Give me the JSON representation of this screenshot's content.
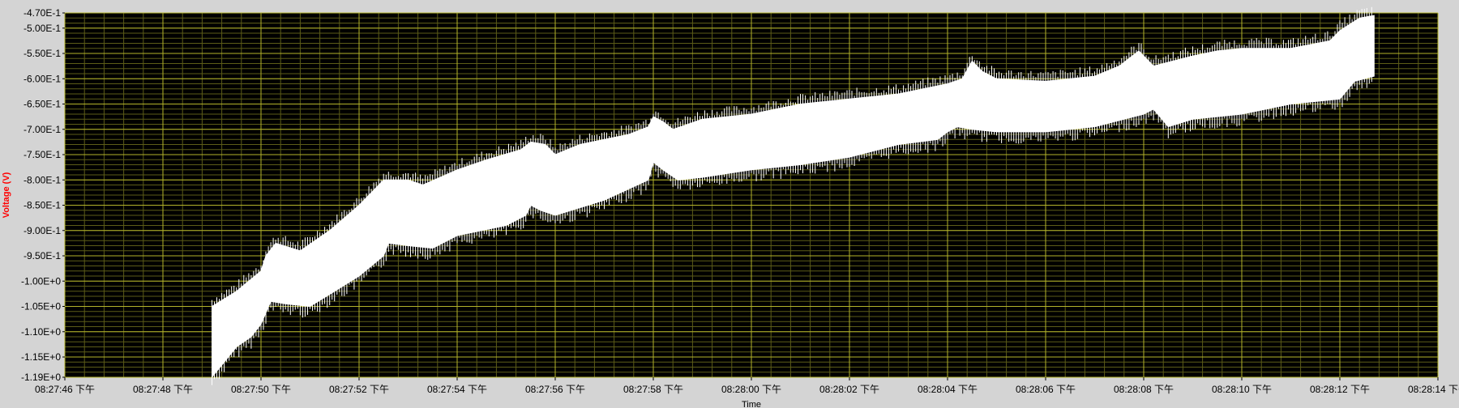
{
  "chart_data": {
    "type": "area",
    "xlabel": "Time",
    "ylabel": "Voltage (V)",
    "xlim": [
      0,
      28
    ],
    "ylim": [
      -1.19,
      -0.47
    ],
    "x_ticks": [
      0,
      2,
      4,
      6,
      8,
      10,
      12,
      14,
      16,
      18,
      20,
      22,
      24,
      26,
      28
    ],
    "x_tick_labels": [
      "08:27:46 下午",
      "08:27:48 下午",
      "08:27:50 下午",
      "08:27:52 下午",
      "08:27:54 下午",
      "08:27:56 下午",
      "08:27:58 下午",
      "08:28:00 下午",
      "08:28:02 下午",
      "08:28:04 下午",
      "08:28:06 下午",
      "08:28:08 下午",
      "08:28:10 下午",
      "08:28:12 下午",
      "08:28:14 下午"
    ],
    "y_ticks": [
      -0.47,
      -0.5,
      -0.55,
      -0.6,
      -0.65,
      -0.7,
      -0.75,
      -0.8,
      -0.85,
      -0.9,
      -0.95,
      -1.0,
      -1.05,
      -1.1,
      -1.15,
      -1.19
    ],
    "y_tick_labels": [
      "-4.70E-1",
      "-5.00E-1",
      "-5.50E-1",
      "-6.00E-1",
      "-6.50E-1",
      "-7.00E-1",
      "-7.50E-1",
      "-8.00E-1",
      "-8.50E-1",
      "-9.00E-1",
      "-9.50E-1",
      "-1.00E+0",
      "-1.05E+0",
      "-1.10E+0",
      "-1.15E+0",
      "-1.19E+0"
    ],
    "grid": true,
    "colors": {
      "plot_background": "#000000",
      "signal": "#ffffff",
      "major_grid": "#b3b32a",
      "minor_grid": "#5c5c18",
      "ylabel": "#ff0000",
      "frame": "#d4d4d4"
    },
    "series": [
      {
        "values_upper": [
          [
            3.0,
            -1.05
          ],
          [
            3.5,
            -1.02
          ],
          [
            4.0,
            -0.98
          ],
          [
            4.1,
            -0.95
          ],
          [
            4.3,
            -0.925
          ],
          [
            4.8,
            -0.94
          ],
          [
            5.4,
            -0.9
          ],
          [
            6.0,
            -0.85
          ],
          [
            6.3,
            -0.82
          ],
          [
            6.5,
            -0.8
          ],
          [
            7.0,
            -0.8
          ],
          [
            7.3,
            -0.81
          ],
          [
            8.0,
            -0.78
          ],
          [
            8.6,
            -0.76
          ],
          [
            9.3,
            -0.74
          ],
          [
            9.5,
            -0.725
          ],
          [
            9.8,
            -0.73
          ],
          [
            10.0,
            -0.75
          ],
          [
            10.5,
            -0.73
          ],
          [
            11.5,
            -0.71
          ],
          [
            11.9,
            -0.695
          ],
          [
            12.0,
            -0.675
          ],
          [
            12.2,
            -0.685
          ],
          [
            12.4,
            -0.7
          ],
          [
            13.0,
            -0.68
          ],
          [
            14.0,
            -0.67
          ],
          [
            15.0,
            -0.65
          ],
          [
            16.0,
            -0.64
          ],
          [
            17.0,
            -0.63
          ],
          [
            18.0,
            -0.61
          ],
          [
            18.3,
            -0.6
          ],
          [
            18.5,
            -0.565
          ],
          [
            18.7,
            -0.585
          ],
          [
            19.0,
            -0.6
          ],
          [
            20.0,
            -0.605
          ],
          [
            21.0,
            -0.595
          ],
          [
            21.5,
            -0.575
          ],
          [
            21.9,
            -0.545
          ],
          [
            22.2,
            -0.575
          ],
          [
            23.0,
            -0.555
          ],
          [
            23.5,
            -0.545
          ],
          [
            24.0,
            -0.54
          ],
          [
            25.0,
            -0.54
          ],
          [
            25.8,
            -0.525
          ],
          [
            26.0,
            -0.505
          ],
          [
            26.4,
            -0.48
          ],
          [
            26.7,
            -0.475
          ]
        ],
        "values_lower": [
          [
            3.0,
            -1.19
          ],
          [
            3.5,
            -1.13
          ],
          [
            3.8,
            -1.11
          ],
          [
            4.0,
            -1.085
          ],
          [
            4.2,
            -1.04
          ],
          [
            4.5,
            -1.045
          ],
          [
            5.0,
            -1.05
          ],
          [
            5.5,
            -1.02
          ],
          [
            6.0,
            -0.99
          ],
          [
            6.5,
            -0.95
          ],
          [
            6.6,
            -0.925
          ],
          [
            7.0,
            -0.93
          ],
          [
            7.5,
            -0.935
          ],
          [
            8.0,
            -0.91
          ],
          [
            9.0,
            -0.89
          ],
          [
            9.4,
            -0.87
          ],
          [
            9.5,
            -0.85
          ],
          [
            9.7,
            -0.86
          ],
          [
            10.0,
            -0.87
          ],
          [
            11.0,
            -0.84
          ],
          [
            11.9,
            -0.8
          ],
          [
            12.0,
            -0.765
          ],
          [
            12.2,
            -0.78
          ],
          [
            12.5,
            -0.8
          ],
          [
            13.0,
            -0.795
          ],
          [
            14.0,
            -0.78
          ],
          [
            15.0,
            -0.77
          ],
          [
            16.0,
            -0.755
          ],
          [
            17.0,
            -0.73
          ],
          [
            17.8,
            -0.72
          ],
          [
            18.0,
            -0.705
          ],
          [
            18.2,
            -0.695
          ],
          [
            18.5,
            -0.7
          ],
          [
            19.0,
            -0.705
          ],
          [
            20.0,
            -0.705
          ],
          [
            21.0,
            -0.695
          ],
          [
            22.0,
            -0.67
          ],
          [
            22.2,
            -0.66
          ],
          [
            22.5,
            -0.695
          ],
          [
            23.0,
            -0.68
          ],
          [
            24.0,
            -0.67
          ],
          [
            25.0,
            -0.65
          ],
          [
            26.0,
            -0.64
          ],
          [
            26.3,
            -0.605
          ],
          [
            26.7,
            -0.595
          ]
        ]
      }
    ]
  }
}
